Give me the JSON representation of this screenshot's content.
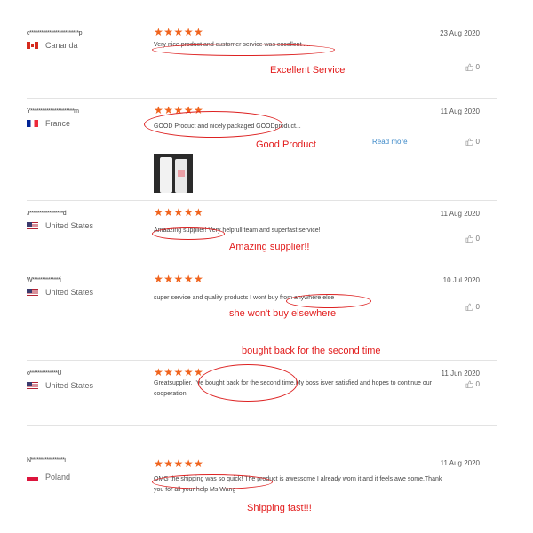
{
  "colors": {
    "star": "#f0641e",
    "annotation": "#e21b1b",
    "link": "#3b88c8",
    "divider": "#e3e3e3"
  },
  "reviews": [
    {
      "user": "c*************************p",
      "country": "Cananda",
      "flag": "canada-flag",
      "stars": "★★★★★",
      "text": "Very nice product and customer service was excellent ....",
      "date": "23 Aug 2020",
      "helpful": "0",
      "annotation": "Excellent Service"
    },
    {
      "user": "Y**********************m",
      "country": "France",
      "flag": "france-flag",
      "stars": "★★★★★",
      "text": "GOOD Product and nicely packaged   GOODproduct...",
      "date": "11 Aug 2020",
      "helpful": "0",
      "read_more": "Read more",
      "annotation": "Good Product"
    },
    {
      "user": "J*****************d",
      "country": "United States",
      "flag": "usa-flag",
      "stars": "★★★★★",
      "text": "Amaazing supplier! Very helpfull team and superfast service!",
      "date": "11 Aug 2020",
      "helpful": "0",
      "annotation": "Amazing supplier!!"
    },
    {
      "user": "W**************i",
      "country": "United States",
      "flag": "usa-flag",
      "stars": "★★★★★",
      "text": "super service and quality products I wont buy from anywhere else",
      "date": "10 Jul 2020",
      "helpful": "0",
      "annotation": "she won't buy elsewhere"
    },
    {
      "user": "o**************U",
      "country": "United States",
      "flag": "usa-flag",
      "stars": "★★★★★",
      "text": "Greatsupplier. I've bought back for the second time.My boss isver satisfied and hopes to continue our cooperation",
      "date": "11 Jun 2020",
      "helpful": "0",
      "annotation": "bought back for the second time"
    },
    {
      "user": "N*****************i",
      "country": "Poland",
      "flag": "poland-flag",
      "stars": "★★★★★",
      "text": "OMG the shipping was so quick! The product is awessome I already worn it and it feels awe some.Thank you for all your help Ms.Wang",
      "date": "11 Aug 2020",
      "helpful": "0",
      "annotation": "Shipping fast!!!"
    }
  ]
}
